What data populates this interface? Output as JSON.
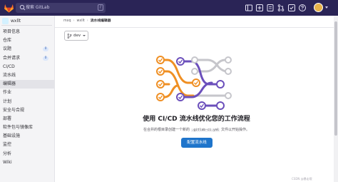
{
  "topbar": {
    "search_placeholder": "搜索 GitLab",
    "search_shortcut": "/",
    "icons": [
      "sidebar-toggle-icon",
      "plus-icon",
      "issues-icon",
      "merge-requests-icon",
      "todo-icon",
      "help-icon",
      "avatar"
    ],
    "colors": {
      "background": "#2a2456",
      "avatar": "#e6b24a"
    }
  },
  "sidebar": {
    "project_name": "wxllt",
    "items": [
      {
        "label": "项目信息"
      },
      {
        "label": "仓库"
      },
      {
        "label": "议题",
        "badge": "0"
      },
      {
        "label": "合并请求",
        "badge": "0"
      },
      {
        "label": "CI/CD"
      },
      {
        "label": "流水线"
      },
      {
        "label": "编辑器",
        "active": true
      },
      {
        "label": "作业"
      },
      {
        "label": "计划"
      },
      {
        "label": "安全与合规"
      },
      {
        "label": "部署"
      },
      {
        "label": "软件包与镜像库"
      },
      {
        "label": "基础设施"
      },
      {
        "label": "监控"
      },
      {
        "label": "分析"
      },
      {
        "label": "Wiki"
      }
    ]
  },
  "breadcrumb": [
    "mxq",
    "wxllt",
    "流水线编辑器"
  ],
  "branch_selector": {
    "value": "dev"
  },
  "empty_state": {
    "title": "使用 CI/CD 流水线优化您的工作流程",
    "description_before": "在合并的根目录创建一个新的",
    "code": ".gitlab-ci.yml",
    "description_after": "文件以开始操作。",
    "button_label": "配置流水线",
    "colors": {
      "button": "#1f75cb",
      "orange": "#ef8f23",
      "purple": "#6b4fbb",
      "grey": "#c6c6cb"
    }
  },
  "watermark": "CSDN @暴走哦"
}
